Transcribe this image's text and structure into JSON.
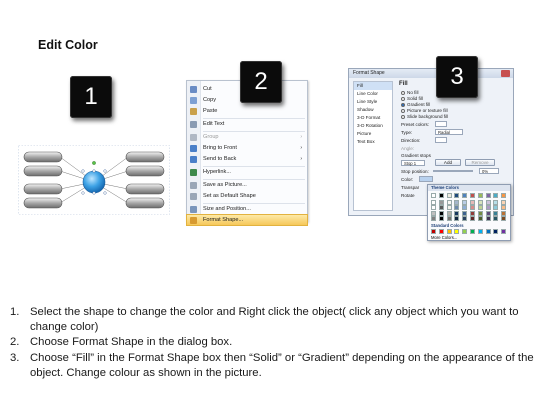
{
  "title": "Edit Color",
  "badges": [
    "1",
    "2",
    "3"
  ],
  "context_menu": {
    "items": [
      {
        "label": "Cut",
        "color": "#6a8cc4",
        "disabled": false
      },
      {
        "label": "Copy",
        "color": "#7ea0d2",
        "disabled": false
      },
      {
        "label": "Paste",
        "color": "#c9a04a",
        "disabled": false
      },
      {
        "label": "Edit Text",
        "color": "#8a9bb2",
        "disabled": false
      },
      {
        "label": "Group",
        "color": "#b0b8c4",
        "disabled": true,
        "arrow": "›"
      },
      {
        "label": "Bring to Front",
        "color": "#4a7fc8",
        "disabled": false,
        "arrow": "›"
      },
      {
        "label": "Send to Back",
        "color": "#4a7fc8",
        "disabled": false,
        "arrow": "›"
      },
      {
        "label": "Hyperlink...",
        "color": "#3e8a4b",
        "disabled": false
      },
      {
        "label": "Save as Picture...",
        "color": "#9aa6b6",
        "disabled": false
      },
      {
        "label": "Set as Default Shape",
        "color": "#9aa6b6",
        "disabled": false
      },
      {
        "label": "Size and Position...",
        "color": "#7a95bb",
        "disabled": false
      },
      {
        "label": "Format Shape...",
        "color": "#d79a30",
        "disabled": false,
        "selected": true
      }
    ]
  },
  "format_dialog": {
    "title": "Format Shape",
    "sidebar": [
      "Fill",
      "Line Color",
      "Line Style",
      "Shadow",
      "3-D Format",
      "3-D Rotation",
      "Picture",
      "Text Box"
    ],
    "heading": "Fill",
    "options": [
      "No fill",
      "Solid fill",
      "Gradient fill",
      "Picture or texture fill",
      "Slide background fill"
    ],
    "preset_label": "Preset colors:",
    "type_label": "Type:",
    "type_value": "Radial",
    "direction_label": "Direction:",
    "angle_label": "Angle:",
    "stops_label": "Gradient stops",
    "stop_value": "Stop 1",
    "add_label": "Add",
    "remove_label": "Remove",
    "stop_position_label": "Stop position:",
    "stop_position_value": "0%",
    "color_label": "Color:",
    "transparency_label": "Transpar",
    "rotate_label": "Rotate"
  },
  "color_picker": {
    "theme_label": "Theme Colors",
    "standard_label": "Standard Colors",
    "more_label": "More Colors...",
    "theme_top": [
      "#ffffff",
      "#000000",
      "#eeece1",
      "#1f497d",
      "#4f81bd",
      "#c0504d",
      "#9bbb59",
      "#8064a2",
      "#4bacc6",
      "#f79646"
    ],
    "standard": [
      "#c00000",
      "#ff0000",
      "#ffc000",
      "#ffff00",
      "#92d050",
      "#00b050",
      "#00b0f0",
      "#0070c0",
      "#002060",
      "#7030a0"
    ]
  },
  "steps": [
    {
      "num": "1.",
      "text": "Select the shape to change the color and Right click the object( click any object which you want to change color)"
    },
    {
      "num": "2.",
      "text": "Choose Format Shape in the dialog box."
    },
    {
      "num": "3.",
      "text": "Choose “Fill” in the Format Shape box then “Solid” or “Gradient” depending on the appearance of the object. Change colour as shown in the picture."
    }
  ]
}
